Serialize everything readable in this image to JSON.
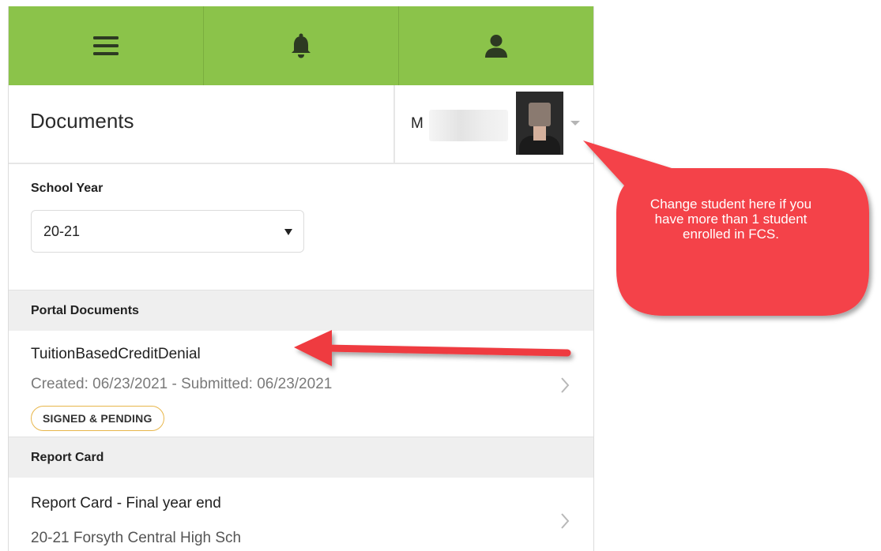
{
  "nav": {
    "items": [
      {
        "icon": "menu-icon"
      },
      {
        "icon": "bell-icon"
      },
      {
        "icon": "user-icon"
      }
    ]
  },
  "header": {
    "title": "Documents",
    "student_initial": "M"
  },
  "school_year": {
    "label": "School Year",
    "value": "20-21"
  },
  "sections": [
    {
      "heading": "Portal Documents",
      "items": [
        {
          "title": "TuitionBasedCreditDenial",
          "meta": "Created: 06/23/2021 - Submitted: 06/23/2021",
          "badge": "SIGNED & PENDING"
        }
      ]
    },
    {
      "heading": "Report Card",
      "items": [
        {
          "title": "Report Card - Final year end",
          "meta": "20-21 Forsyth Central High Sch"
        }
      ]
    }
  ],
  "callout": {
    "text": "Change student here if you have more than 1 student enrolled in FCS."
  },
  "colors": {
    "nav_green": "#8bc34a",
    "callout_red": "#f4434a",
    "badge_border": "#e8b64a"
  }
}
